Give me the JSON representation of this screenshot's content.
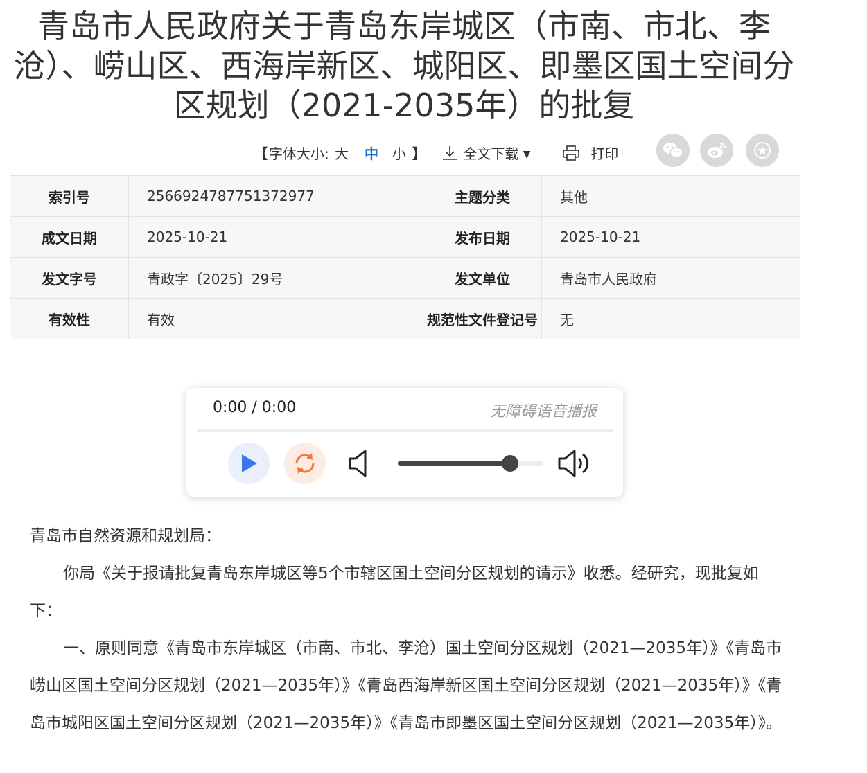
{
  "title": {
    "line1": "青岛市人民政府关于青岛东岸城区（市南、市北、李",
    "line2": "沧）、崂山区、西海岸新区、城阳区、即墨区国土空间分",
    "line3": "区规划（2021-2035年）的批复"
  },
  "toolbar": {
    "bracket_left": "【",
    "font_size_label": "字体大小:",
    "size_big": "大",
    "size_mid": "中",
    "size_small": "小",
    "bracket_right": "】",
    "download_label": "全文下载",
    "print_label": "打印"
  },
  "share": {
    "icons": [
      "wechat-icon",
      "weibo-icon",
      "star-icon"
    ]
  },
  "meta": {
    "rows": [
      {
        "k1": "索引号",
        "v1": "2566924787751372977",
        "k2": "主题分类",
        "v2": "其他"
      },
      {
        "k1": "成文日期",
        "v1": "2025-10-21",
        "k2": "发布日期",
        "v2": "2025-10-21"
      },
      {
        "k1": "发文字号",
        "v1": "青政字〔2025〕29号",
        "k2": "发文单位",
        "v2": "青岛市人民政府"
      },
      {
        "k1": "有效性",
        "v1": "有效",
        "k2": "规范性文件登记号",
        "v2": "无"
      }
    ]
  },
  "player": {
    "time": "0:00 / 0:00",
    "hint": "无障碍语音播报",
    "volume": 0.77,
    "colors": {
      "play": "#3b78e7",
      "loop": "#f07a36"
    }
  },
  "content": {
    "salutation": "青岛市自然资源和规划局：",
    "para1": "你局《关于报请批复青岛东岸城区等5个市辖区国土空间分区规划的请示》收悉。经研究，现批复如下：",
    "para2": "一、原则同意《青岛市东岸城区（市南、市北、李沧）国土空间分区规划（2021—2035年）》《青岛市崂山区国土空间分区规划（2021—2035年）》《青岛西海岸新区国土空间分区规划（2021—2035年）》《青岛市城阳区国土空间分区规划（2021—2035年）》《青岛市即墨区国土空间分区规划（2021—2035年）》。"
  }
}
